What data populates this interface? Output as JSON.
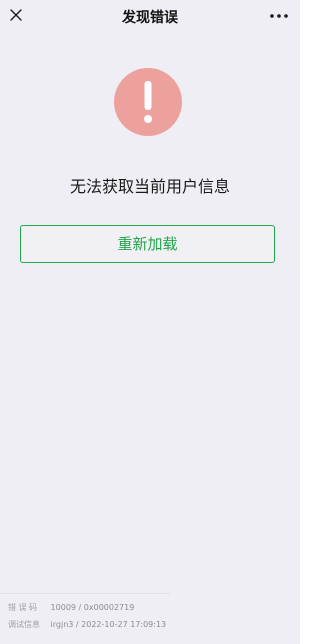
{
  "nav": {
    "title": "发现错误",
    "close_icon": "close-icon",
    "more_icon": "more-icon"
  },
  "error": {
    "icon": "exclamation-icon",
    "icon_color": "#eda19c",
    "message": "无法获取当前用户信息",
    "reload_label": "重新加载",
    "accent_color": "#22a64b"
  },
  "info": {
    "code_label": "错误码",
    "code_value": "10009 / 0x00002719",
    "debug_label": "调试信息",
    "debug_value": "irgjn3 / 2022-10-27 17:09:13"
  }
}
